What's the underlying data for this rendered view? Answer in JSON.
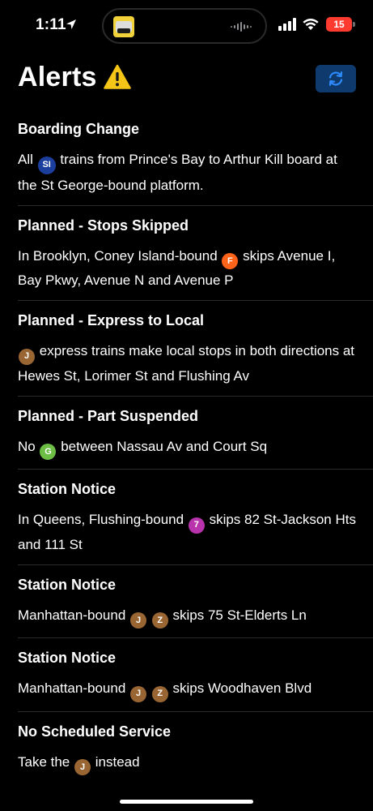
{
  "status": {
    "time": "1:11",
    "battery": "15"
  },
  "header": {
    "title": "Alerts"
  },
  "colors": {
    "si": "#1c3f9e",
    "f": "#ff6319",
    "jz": "#996633",
    "g": "#6cbe45",
    "seven": "#b933ad",
    "refresh_bg": "#0e3a6e",
    "accent": "#2f8cff"
  },
  "alerts": [
    {
      "title": "Boarding Change",
      "pre": "All",
      "bullet": "SI",
      "post": "trains from Prince's Bay to Arthur Kill board at the St George-bound platform."
    },
    {
      "title": "Planned - Stops Skipped",
      "pre": "In Brooklyn, Coney Island-bound",
      "bullet": "F",
      "post": "skips Avenue I, Bay Pkwy, Avenue N and Avenue P"
    },
    {
      "title": "Planned - Express to Local",
      "pre": "",
      "bullet": "J",
      "post": "express trains make local stops in both directions at Hewes St, Lorimer St and Flushing Av"
    },
    {
      "title": "Planned - Part Suspended",
      "pre": "No",
      "bullet": "G",
      "post": "between Nassau Av and Court Sq"
    },
    {
      "title": "Station Notice",
      "pre": "In Queens, Flushing-bound",
      "bullet": "7",
      "post": "skips 82 St-Jackson Hts and 111 St"
    },
    {
      "title": "Station Notice",
      "pre": "Manhattan-bound",
      "bullet": "J",
      "bullet2": "Z",
      "post": "skips 75 St-Elderts Ln"
    },
    {
      "title": "Station Notice",
      "pre": "Manhattan-bound",
      "bullet": "J",
      "bullet2": "Z",
      "post": "skips Woodhaven Blvd"
    },
    {
      "title": "No Scheduled Service",
      "pre": "Take the",
      "bullet": "J",
      "post": "instead"
    }
  ]
}
